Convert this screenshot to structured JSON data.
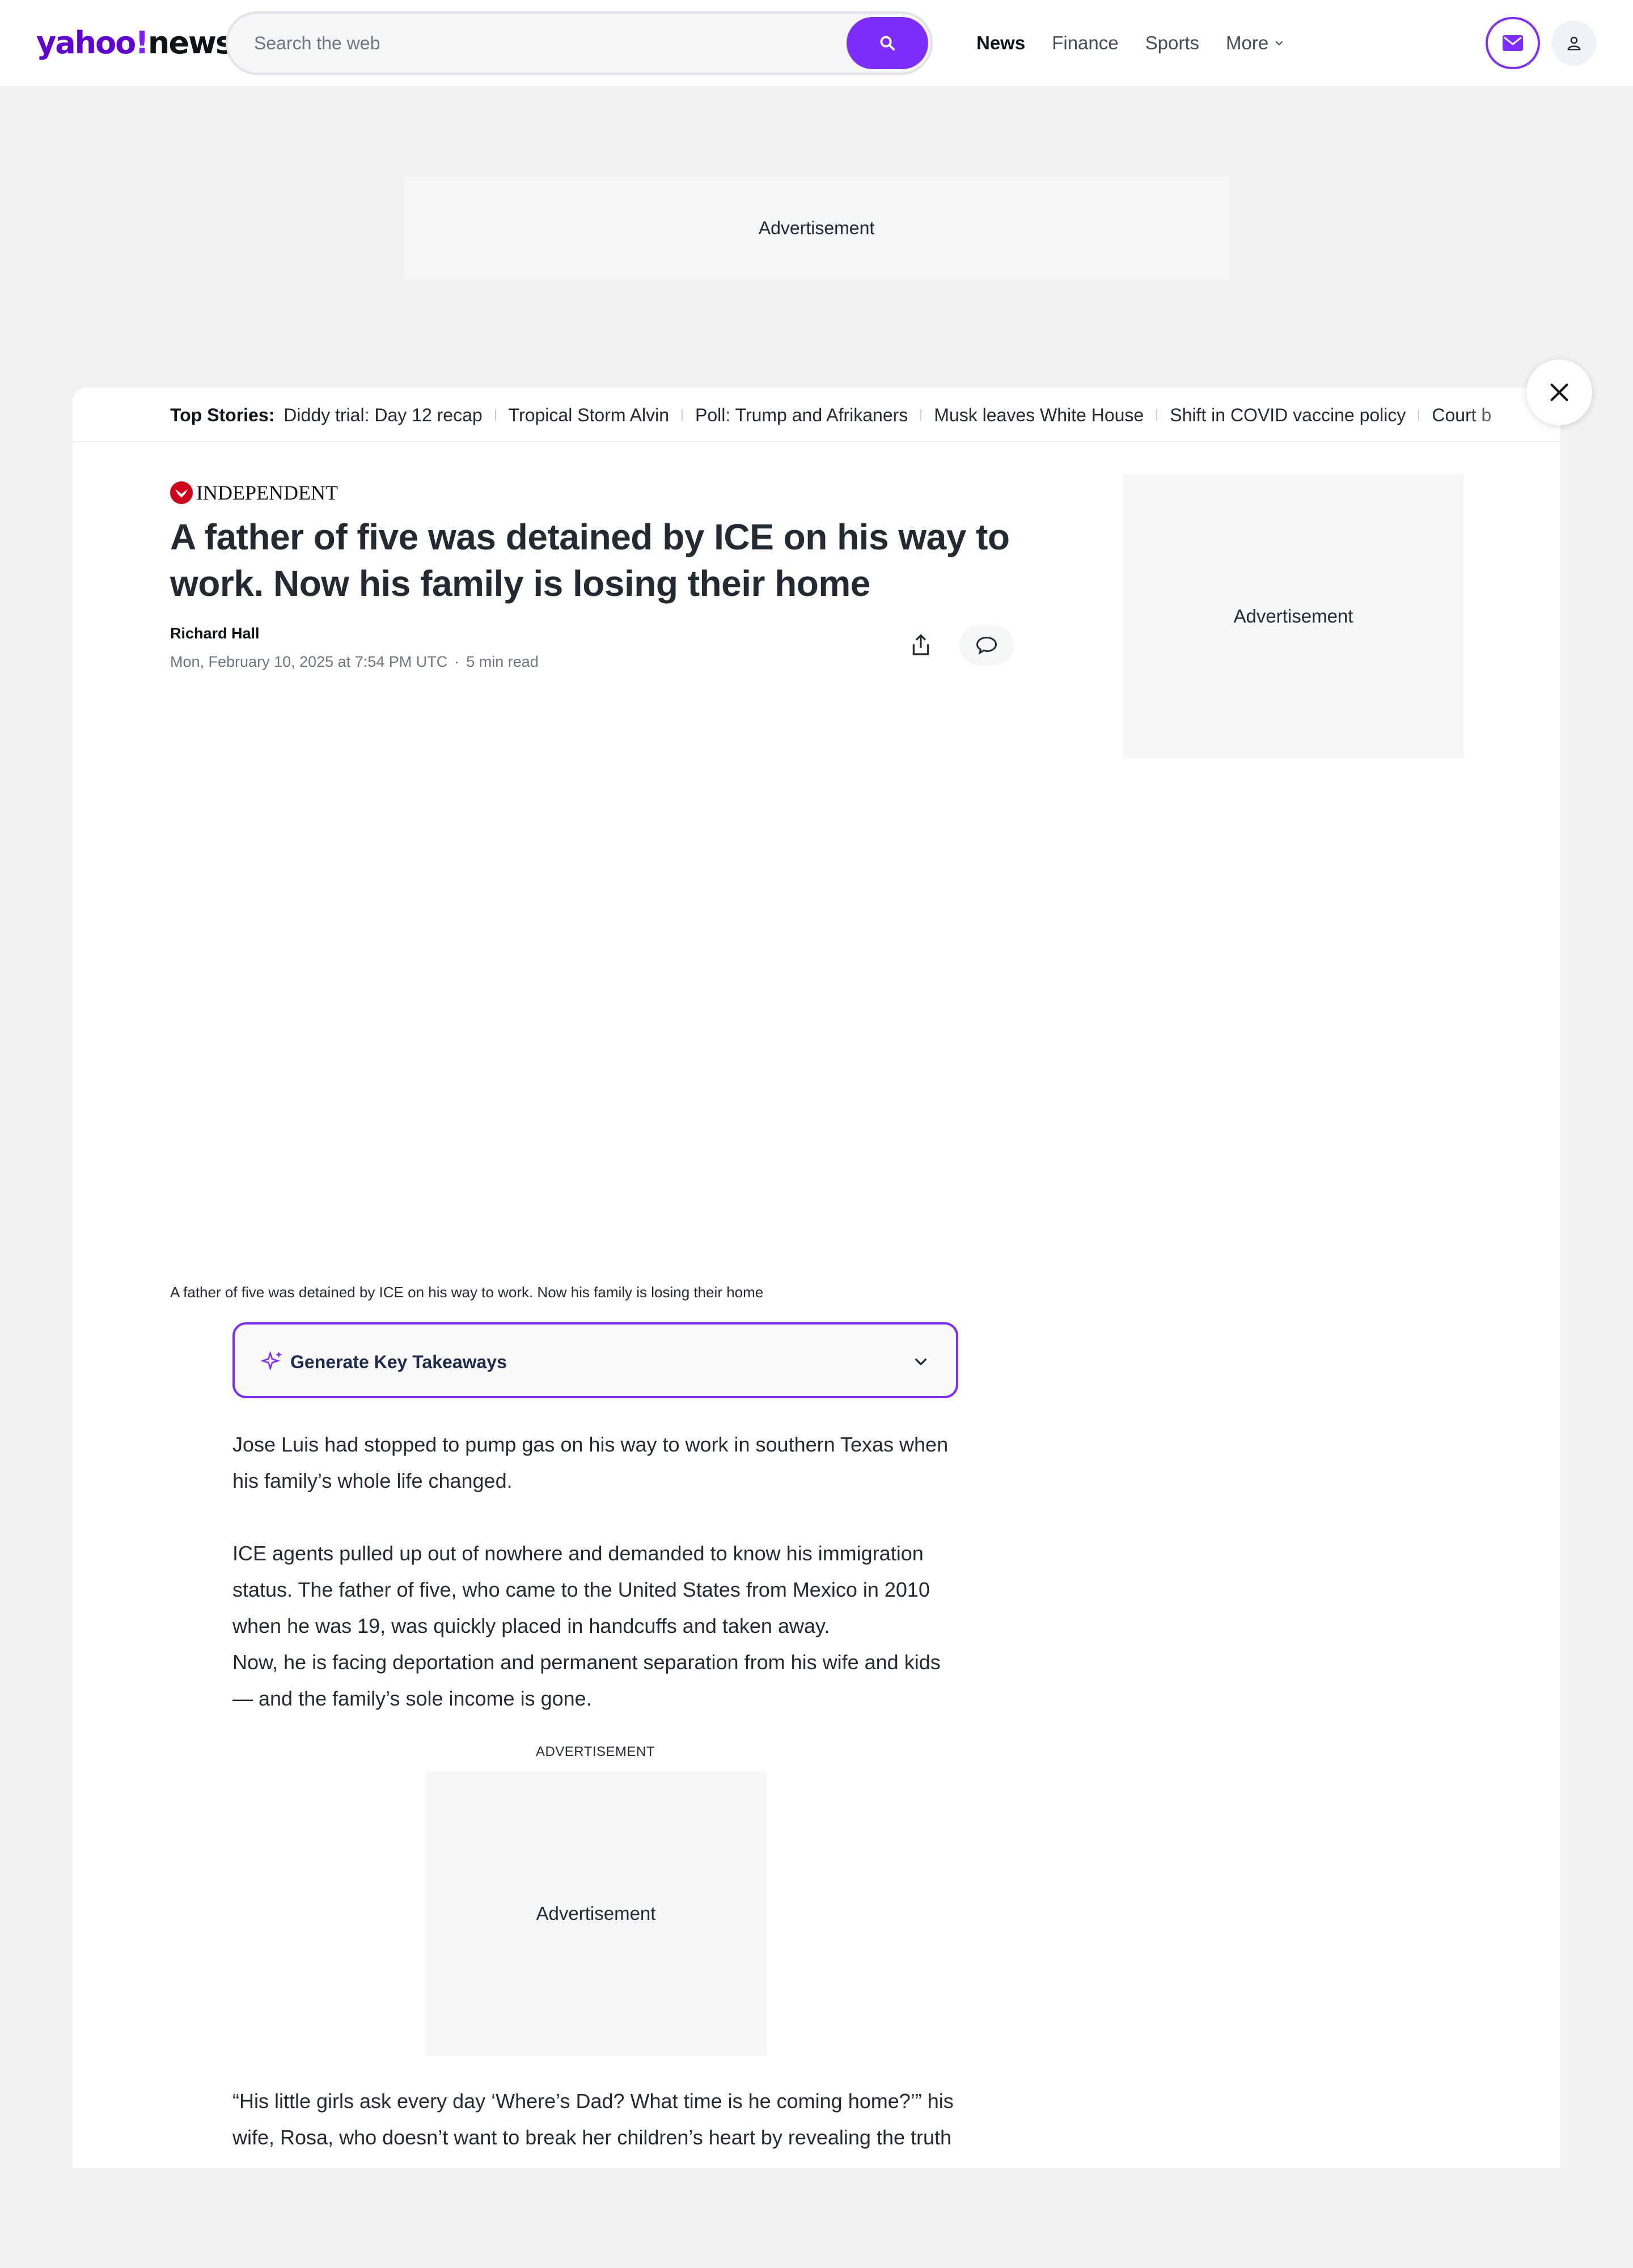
{
  "header": {
    "logo_main": "yahoo",
    "logo_slash": "!",
    "logo_news": "news",
    "search_placeholder": "Search the web",
    "nav": [
      "News",
      "Finance",
      "Sports",
      "More"
    ],
    "accent_color": "#7d2eff"
  },
  "ads": {
    "top": "Advertisement",
    "side": "Advertisement",
    "inline_label": "ADVERTISEMENT",
    "inline": "Advertisement"
  },
  "top_stories": {
    "label": "Top Stories:",
    "items": [
      "Diddy trial: Day 12 recap",
      "Tropical Storm Alvin",
      "Poll: Trump and Afrikaners",
      "Musk leaves White House",
      "Shift in COVID vaccine policy",
      "Court b"
    ]
  },
  "article": {
    "publisher": "INDEPENDENT",
    "headline": "A father of five was detained by ICE on his way to work. Now his family is losing their home",
    "author": "Richard Hall",
    "date": "Mon, February 10, 2025 at 7:54 PM UTC",
    "read_time": "5 min read",
    "caption": "A father of five was detained by ICE on his way to work. Now his family is losing their home",
    "takeaways_label": "Generate Key Takeaways",
    "paragraphs": [
      "Jose Luis had stopped to pump gas on his way to work in southern Texas when his family’s whole life changed.",
      "ICE agents pulled up out of nowhere and demanded to know his immigration status. The father of five, who came to the United States from Mexico in 2010 when he was 19, was quickly placed in handcuffs and taken away.",
      "Now, he is facing deportation and permanent separation from his wife and kids — and the family’s sole income is gone.",
      "“His little girls ask every day ‘Where’s Dad? What time is he coming home?’” his wife, Rosa, who doesn’t want to break her children’s heart by revealing the truth"
    ]
  },
  "icons": {
    "search": "search-icon",
    "mail": "mail-icon",
    "user": "user-icon",
    "close": "close-icon",
    "share": "share-icon",
    "comment": "comment-icon",
    "sparkle": "sparkle-icon",
    "chevron": "chevron-down-icon"
  }
}
